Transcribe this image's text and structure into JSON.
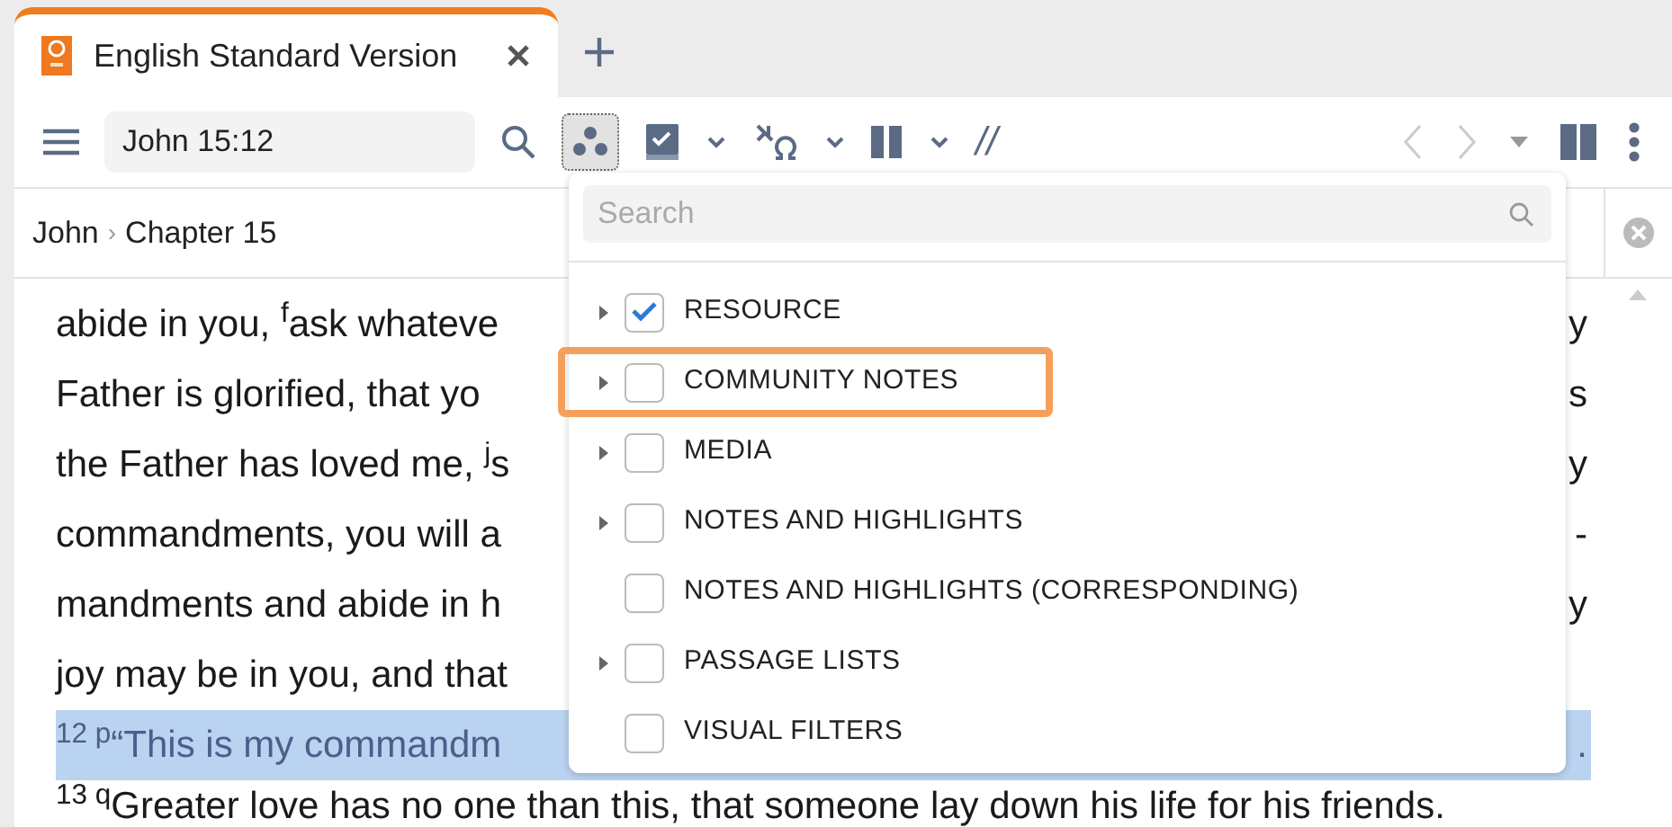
{
  "tab": {
    "title": "English Standard Version",
    "selected": true
  },
  "toolbar": {
    "reference": "John 15:12",
    "parallel": "//",
    "filter_active": true
  },
  "breadcrumb": {
    "book": "John",
    "separator": "›",
    "chapter": "Chapter 15"
  },
  "text_lines": [
    {
      "left": "abide in you, $^{f}$ask whateve",
      "right": "y",
      "highlighted": false
    },
    {
      "left": "Father is glorified, that yo",
      "right": "s",
      "highlighted": false
    },
    {
      "left": "the Father has loved me, $^{j}$s",
      "right": "y",
      "highlighted": false
    },
    {
      "left": "commandments, you will a",
      "right": "-",
      "highlighted": false
    },
    {
      "left": "mandments and abide in h",
      "right": "y",
      "highlighted": false
    },
    {
      "left": "joy may be in you, and that",
      "highlighted": false
    },
    {
      "left": "$^{12 p}$“This is my commandm",
      "right": ".",
      "highlighted": true
    },
    {
      "left": "$^{13 q}$Greater love has no one than this, that someone lay down his life for his friends.",
      "highlighted": false
    }
  ],
  "dropdown": {
    "search": {
      "placeholder": "Search"
    },
    "items": [
      {
        "label": "RESOURCE",
        "checked": true,
        "expandable": true,
        "outlined": false
      },
      {
        "label": "COMMUNITY NOTES",
        "checked": false,
        "expandable": true,
        "outlined": true
      },
      {
        "label": "MEDIA",
        "checked": false,
        "expandable": true,
        "outlined": false
      },
      {
        "label": "NOTES AND HIGHLIGHTS",
        "checked": false,
        "expandable": true,
        "outlined": false
      },
      {
        "label": "NOTES AND HIGHLIGHTS (CORRESPONDING)",
        "checked": false,
        "expandable": false,
        "outlined": false
      },
      {
        "label": "PASSAGE LISTS",
        "checked": false,
        "expandable": true,
        "outlined": false
      },
      {
        "label": "VISUAL FILTERS",
        "checked": false,
        "expandable": false,
        "outlined": false
      }
    ]
  }
}
